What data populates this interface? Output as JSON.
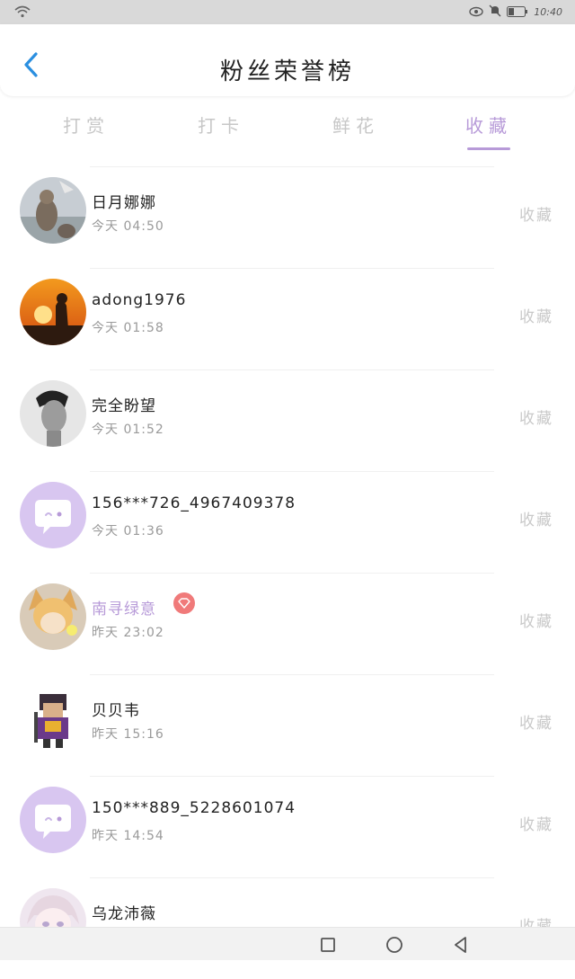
{
  "status_bar": {
    "time": "10:40"
  },
  "header": {
    "title": "粉丝荣誉榜"
  },
  "tabs": [
    {
      "label": "打赏",
      "active": false
    },
    {
      "label": "打卡",
      "active": false
    },
    {
      "label": "鲜花",
      "active": false
    },
    {
      "label": "收藏",
      "active": true
    }
  ],
  "accent_color": "#b79ad8",
  "fans": [
    {
      "name": "日月娜娜",
      "time": "今天 04:50",
      "action": "收藏",
      "avatar": "photo-cat"
    },
    {
      "name": "adong1976",
      "time": "今天 01:58",
      "action": "收藏",
      "avatar": "photo-sunset-buddha"
    },
    {
      "name": "完全盼望",
      "time": "今天 01:52",
      "action": "收藏",
      "avatar": "photo-portrait"
    },
    {
      "name": "156***726_4967409378",
      "time": "今天 01:36",
      "action": "收藏",
      "avatar": "default-chat-avatar"
    },
    {
      "name": "南寻绿意",
      "time": "昨天 23:02",
      "action": "收藏",
      "avatar": "anime-fox-girl",
      "vip_badge": "diamond-icon"
    },
    {
      "name": "贝贝韦",
      "time": "昨天 15:16",
      "action": "收藏",
      "avatar": "pixel-warrior"
    },
    {
      "name": "150***889_5228601074",
      "time": "昨天 14:54",
      "action": "收藏",
      "avatar": "default-chat-avatar"
    },
    {
      "name": "乌龙沛薇",
      "time": "",
      "action": "收藏",
      "avatar": "anime-girl"
    }
  ]
}
